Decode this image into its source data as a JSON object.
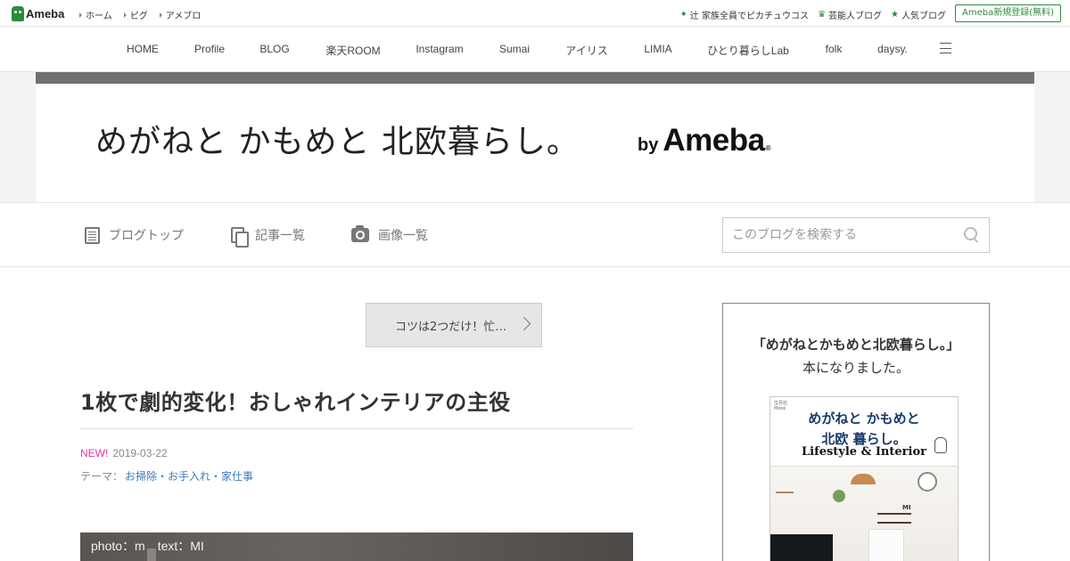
{
  "topbar": {
    "logo_text": "Ameba",
    "links": [
      "ホーム",
      "ピグ",
      "アメブロ"
    ],
    "right_links": [
      {
        "icon": "plus-icon",
        "label": "辻 家族全員でピカチュウコス"
      },
      {
        "icon": "crown-icon",
        "label": "芸能人ブログ"
      },
      {
        "icon": "star-icon",
        "label": "人気ブログ"
      }
    ],
    "signup_label": "Ameba新規登録(無料)",
    "accent_color": "#2d8c3c"
  },
  "global_nav": {
    "items": [
      "HOME",
      "Profile",
      "BLOG",
      "楽天ROOM",
      "Instagram",
      "Sumai",
      "アイリス",
      "LIMIA",
      "ひとり暮らしLab",
      "folk",
      "daysy."
    ],
    "menu_icon": "hamburger-menu-icon"
  },
  "header": {
    "blog_title": "めがねと かもめと 北欧暮らし。",
    "by": "by",
    "ameba": "Ameba",
    "reg_mark": "®",
    "strip_color": "#717171"
  },
  "blog_nav": {
    "items": [
      {
        "icon": "list-icon",
        "label": "ブログトップ"
      },
      {
        "icon": "documents-icon",
        "label": "記事一覧"
      },
      {
        "icon": "camera-icon",
        "label": "画像一覧"
      }
    ],
    "search_placeholder": "このブログを検索する"
  },
  "article": {
    "prev_link": "コツは2つだけ！忙…",
    "title": "1枚で劇的変化！おしゃれインテリアの主役",
    "new_badge": "NEW!",
    "date": "2019-03-22",
    "theme_label": "テーマ：",
    "theme": "お掃除・お手入れ・家仕事",
    "photo_caption": "photo：m　text：MI",
    "new_color": "#e0389f",
    "theme_color": "#3b7bbf"
  },
  "sidebar": {
    "heading": "「めがねとかもめと北欧暮らし。」",
    "subheading": "本になりました。",
    "book": {
      "tag": "宝島社\nMook",
      "title_line1": "めがねと かもめと",
      "title_line2": "北欧 暮らし。",
      "title_line3": "Lifestyle & Interior",
      "author": "MI"
    }
  }
}
